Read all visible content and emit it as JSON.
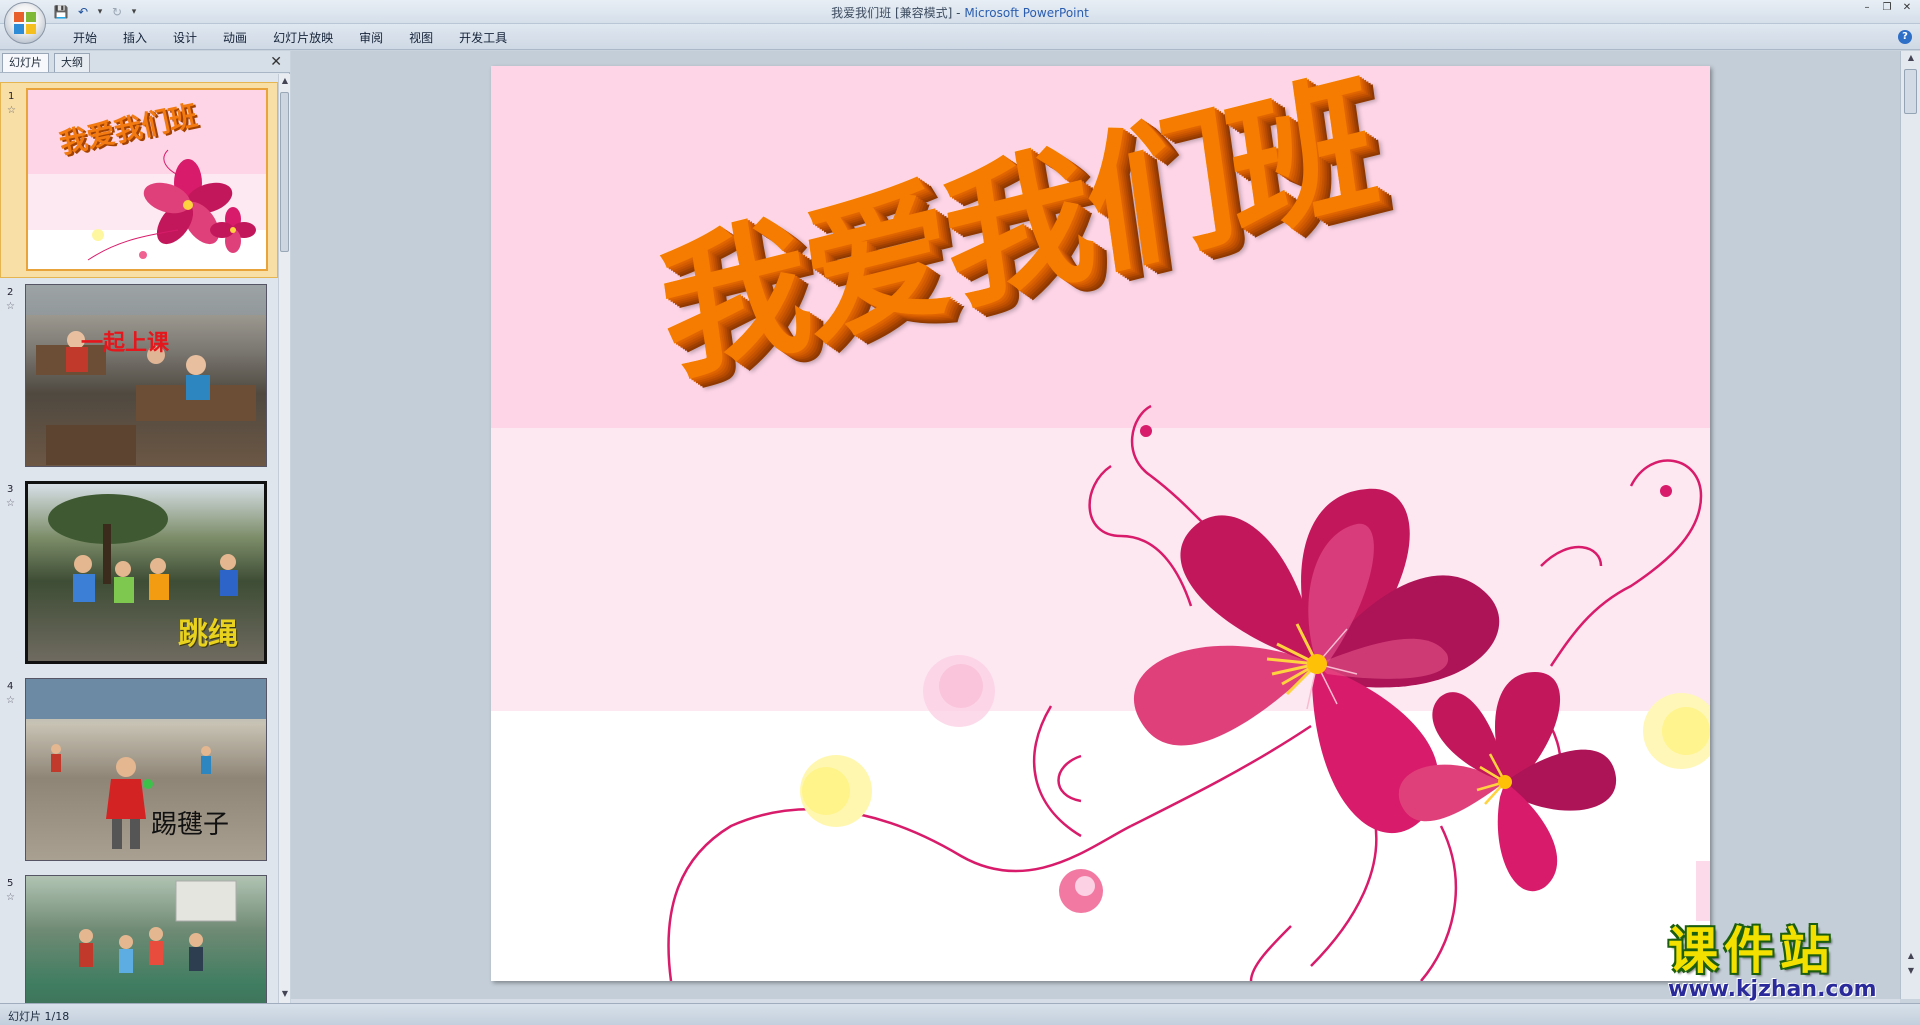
{
  "window": {
    "doc_title": "我爱我们班 [兼容模式]",
    "separator": " - ",
    "app_name": "Microsoft PowerPoint"
  },
  "ribbon": {
    "tabs": [
      "开始",
      "插入",
      "设计",
      "动画",
      "幻灯片放映",
      "审阅",
      "视图",
      "开发工具"
    ]
  },
  "left_pane": {
    "tabs": [
      "幻灯片",
      "大纲"
    ],
    "thumbnails": [
      {
        "number": "1",
        "title": "我爱我们班"
      },
      {
        "number": "2",
        "label": "一起上课"
      },
      {
        "number": "3",
        "label": "跳绳"
      },
      {
        "number": "4",
        "label": "踢毽子"
      },
      {
        "number": "5"
      }
    ]
  },
  "slide": {
    "title": "我爱我们班"
  },
  "status": {
    "slide_indicator": "幻灯片 1/18"
  },
  "watermark": {
    "logo_text": "课件站",
    "url": "www.kjzhan.com"
  },
  "colors": {
    "slide_band_top": "#fdd5e7",
    "slide_band_mid": "#fde8f2",
    "title_orange": "#f57c00",
    "flower_magenta": "#d81b6a",
    "selected_thumb": "#f8dfa6"
  }
}
